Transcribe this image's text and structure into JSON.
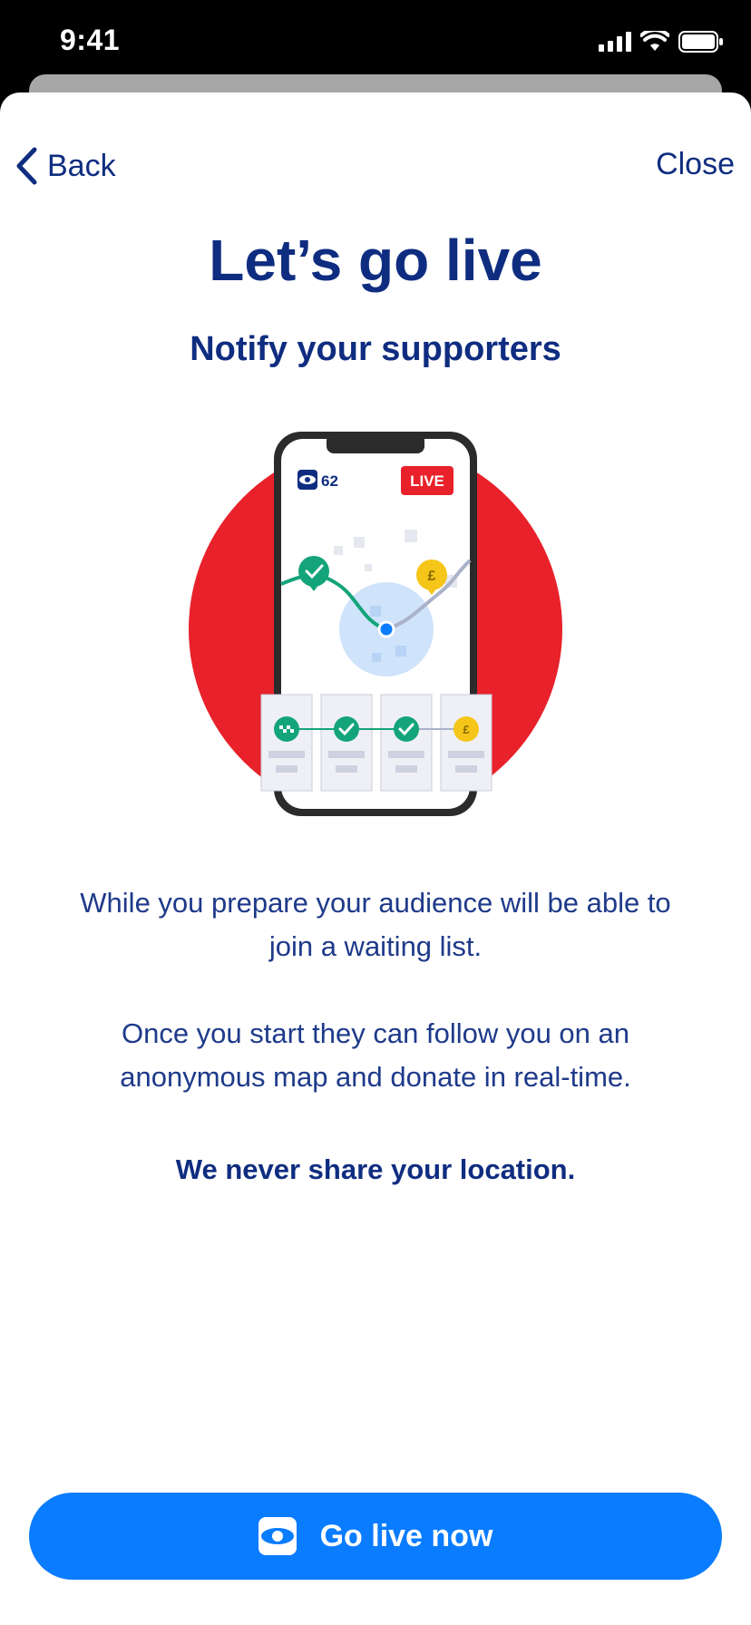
{
  "status_bar": {
    "time": "9:41"
  },
  "nav": {
    "back_label": "Back",
    "close_label": "Close"
  },
  "header": {
    "title": "Let’s go live",
    "subtitle": "Notify your supporters"
  },
  "illustration": {
    "viewers": "62",
    "live_badge": "LIVE",
    "pound_symbol": "£"
  },
  "body": {
    "para1": "While you prepare your audience will be able to join a waiting list.",
    "para2": "Once you start they can follow you on an anonymous map and donate in real-time.",
    "para3": "We never share your location."
  },
  "cta": {
    "label": "Go live now",
    "icon": "eye-icon"
  },
  "colors": {
    "brand_navy": "#0f2d80",
    "cta_blue": "#0a7cff",
    "accent_red": "#e8212a",
    "success_green": "#14a47a",
    "coin_yellow": "#f5c518"
  }
}
